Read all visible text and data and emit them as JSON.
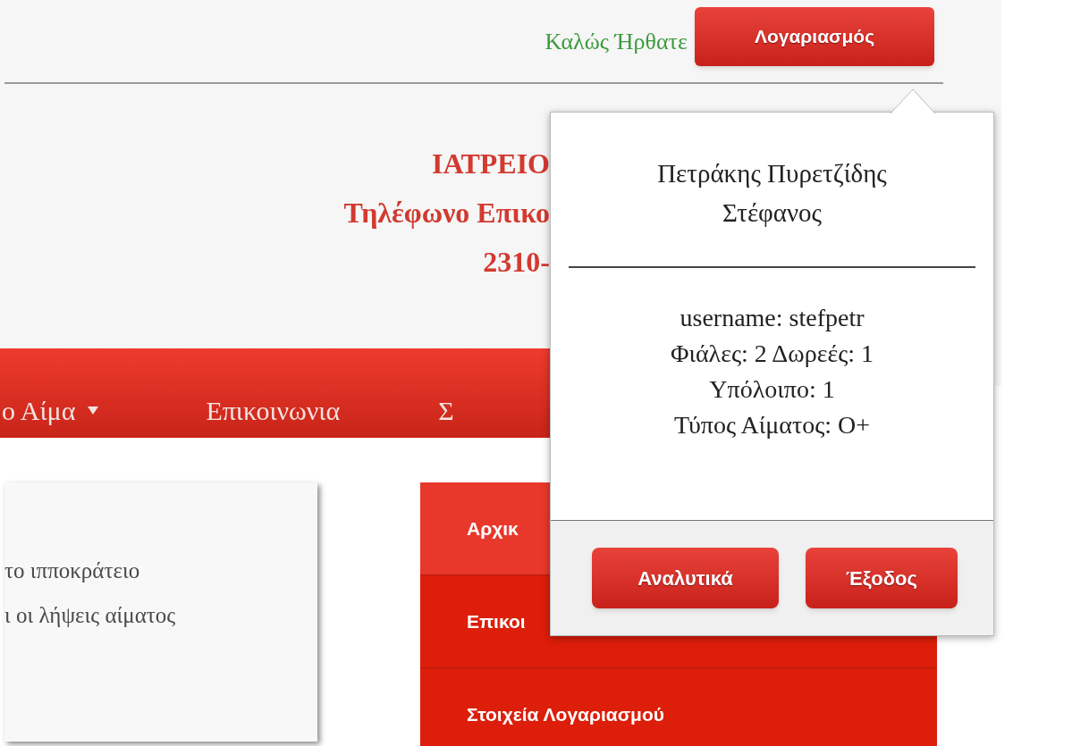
{
  "top_bar": {
    "greeting": "Καλώς Ήρθατε",
    "account_button": "Λογαριασμός"
  },
  "header": {
    "lines": [
      "ΙΑΤΡΕΙΟ",
      "Τηλέφωνο Επικο",
      "2310-"
    ]
  },
  "nav": {
    "items": [
      {
        "label": "ο Αίμα",
        "dropdown": true
      },
      {
        "label": "Επικοινωνια",
        "dropdown": false
      },
      {
        "label": "Σ",
        "dropdown": false
      }
    ]
  },
  "content_card": {
    "lines": [
      "το ιπποκράτειο",
      "ι οι λήψεις αίματος"
    ]
  },
  "side_menu": {
    "items": [
      {
        "label": "Αρχικ",
        "selected": true
      },
      {
        "label": "Επικοι",
        "selected": false
      },
      {
        "label": "Στοιχεία Λογαριασμού",
        "selected": false
      }
    ]
  },
  "account_popup": {
    "name": "Πετράκης Πυρετζίδης Στέφανος",
    "details": [
      "username: stefpetr",
      "Φιάλες: 2 Δωρεές: 1",
      "Υπόλοιπο: 1",
      "Τύπος Αίματος: O+"
    ],
    "buttons": [
      "Αναλυτικά",
      "Έξοδος"
    ]
  }
}
